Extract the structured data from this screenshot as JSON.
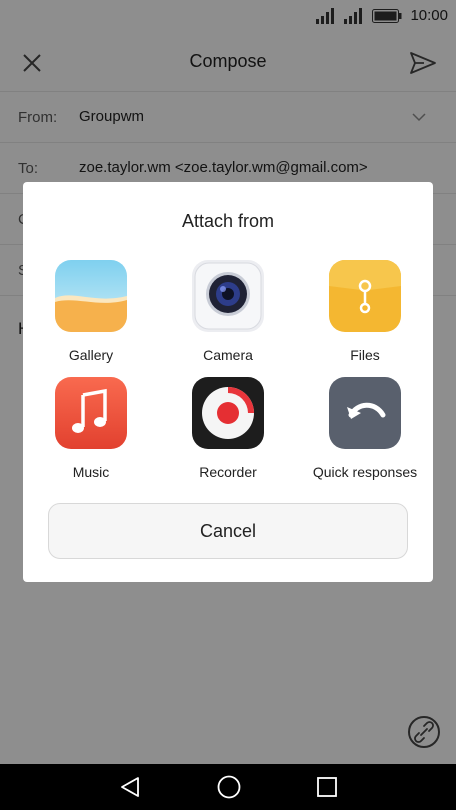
{
  "status_bar": {
    "time": "10:00"
  },
  "app_bar": {
    "title": "Compose"
  },
  "fields": {
    "from_label": "From:",
    "from_value": "Groupwm",
    "to_label": "To:",
    "to_value": "zoe.taylor.wm <zoe.taylor.wm@gmail.com>",
    "cc_label": "C",
    "subject_label": "S",
    "body_partial": "H"
  },
  "dialog": {
    "title": "Attach from",
    "options": [
      {
        "label": "Gallery",
        "icon": "gallery-icon"
      },
      {
        "label": "Camera",
        "icon": "camera-icon"
      },
      {
        "label": "Files",
        "icon": "files-icon"
      },
      {
        "label": "Music",
        "icon": "music-note-icon"
      },
      {
        "label": "Recorder",
        "icon": "recorder-icon"
      },
      {
        "label": "Quick responses",
        "icon": "undo-arrow-icon"
      }
    ],
    "cancel_label": "Cancel"
  },
  "colors": {
    "scrim": "#6b6b6b",
    "files_accent": "#f4b731",
    "music_accent": "#f1523f"
  }
}
